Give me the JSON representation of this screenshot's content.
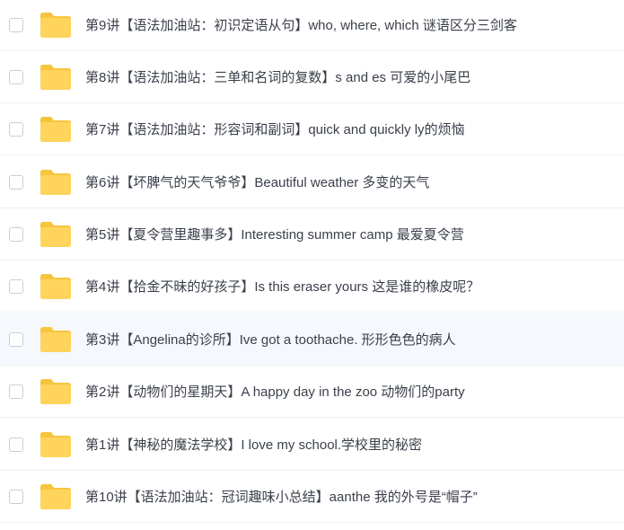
{
  "file_list": {
    "items": [
      {
        "name": "第9讲【语法加油站：初识定语从句】who, where, which 谜语区分三剑客",
        "icon": "folder-icon",
        "highlighted": false
      },
      {
        "name": "第8讲【语法加油站：三单和名词的复数】s and es 可爱的小尾巴",
        "icon": "folder-icon",
        "highlighted": false
      },
      {
        "name": "第7讲【语法加油站：形容词和副词】quick and quickly ly的烦恼",
        "icon": "folder-icon",
        "highlighted": false
      },
      {
        "name": "第6讲【坏脾气的天气爷爷】Beautiful weather 多变的天气",
        "icon": "folder-icon",
        "highlighted": false
      },
      {
        "name": "第5讲【夏令营里趣事多】Interesting summer camp 最爱夏令营",
        "icon": "folder-icon",
        "highlighted": false
      },
      {
        "name": "第4讲【拾金不昧的好孩子】Is this eraser yours 这是谁的橡皮呢？",
        "icon": "folder-icon",
        "highlighted": false
      },
      {
        "name": "第3讲【Angelina的诊所】Ive got a toothache. 形形色色的病人",
        "icon": "folder-icon",
        "highlighted": true
      },
      {
        "name": "第2讲【动物们的星期天】A happy day in the zoo 动物们的party",
        "icon": "folder-icon",
        "highlighted": false
      },
      {
        "name": "第1讲【神秘的魔法学校】I love my school.学校里的秘密",
        "icon": "folder-icon",
        "highlighted": false
      },
      {
        "name": "第10讲【语法加油站：冠词趣味小总结】aanthe 我的外号是“帽子”",
        "icon": "folder-icon",
        "highlighted": false
      }
    ]
  },
  "colors": {
    "folder": "#ffd45c",
    "folder_tab": "#f7c43d",
    "text": "#3a3f4a",
    "highlight_row": "#f5f8fc",
    "divider": "#eef0f3",
    "checkbox_border": "#c9ced6"
  }
}
